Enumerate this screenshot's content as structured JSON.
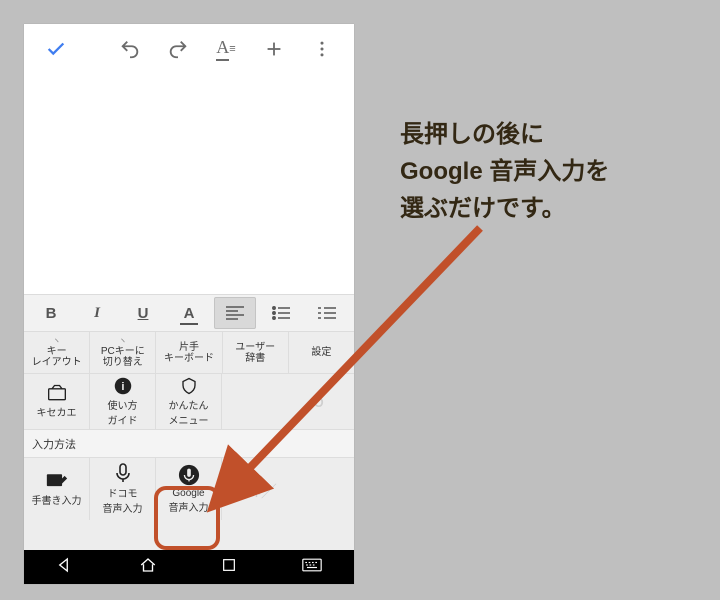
{
  "annotation": {
    "line1": "長押しの後に",
    "line2": "Google 音声入力を",
    "line3": "選ぶだけです。"
  },
  "topbar": {
    "check": "✓",
    "undo": "↶",
    "redo": "↷",
    "textformat": "A",
    "plus": "+",
    "more": "⋮"
  },
  "fmtbar": {
    "bold": "B",
    "italic": "I",
    "underline": "U",
    "color": "A"
  },
  "kb": {
    "row1": {
      "key_layout": "キー\nレイアウト",
      "pc_key": "PCキーに\n切り替え",
      "one_hand": "片手\nキーボード",
      "user_dict": "ユーザー\n辞書",
      "settings": "設定"
    },
    "row2": {
      "kisekae": "キセカエ",
      "guide": "使い方\nガイド",
      "easy_menu": "かんたん\nメニュー",
      "ghost_num": "6"
    },
    "header": "入力方法",
    "row3": {
      "handwriting": "手書き入力",
      "docomo": "ドコモ\n音声入力",
      "google": "Google\n音声入力",
      "ghost_yen": "¥／"
    }
  }
}
